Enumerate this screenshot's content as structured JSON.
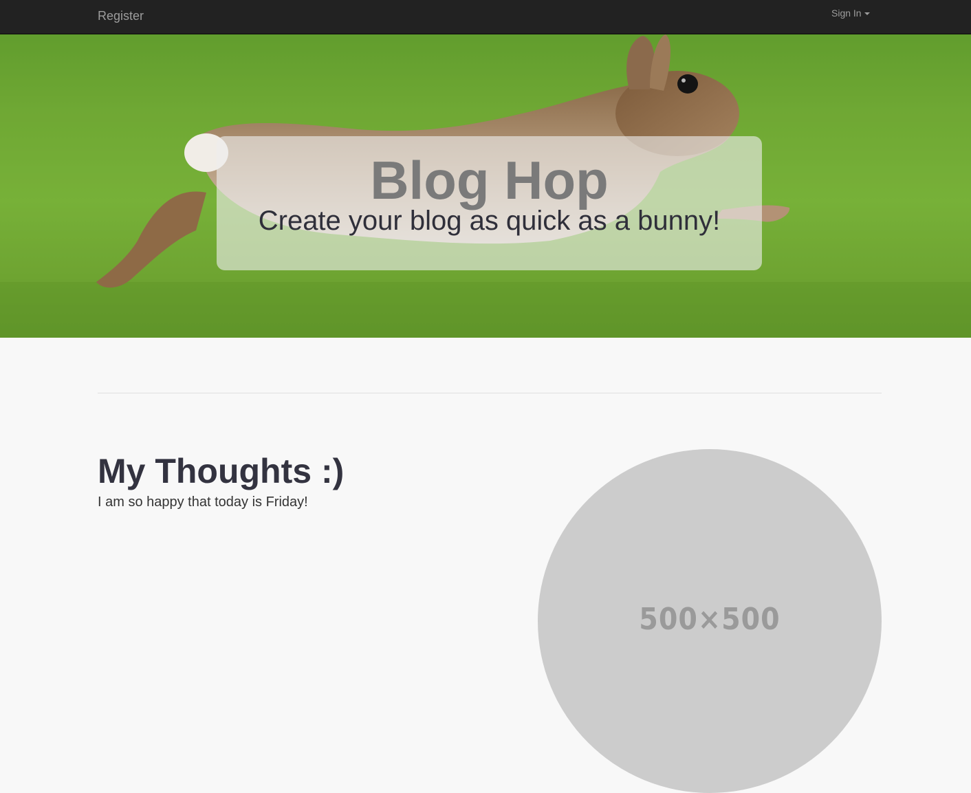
{
  "navbar": {
    "brand_label": "Register",
    "signin_label": "Sign In"
  },
  "hero": {
    "title": "Blog Hop",
    "subtitle": "Create your blog as quick as a bunny!"
  },
  "post": {
    "title": "My Thoughts :)",
    "body": "I am so happy that today is Friday!"
  },
  "image_placeholder": {
    "label": "500×500"
  },
  "colors": {
    "navbar_bg": "#222222",
    "nav_text": "#9d9d9d",
    "page_bg": "#f8f8f8",
    "grass": "#7ab43a",
    "placeholder_bg": "#cccccc"
  }
}
